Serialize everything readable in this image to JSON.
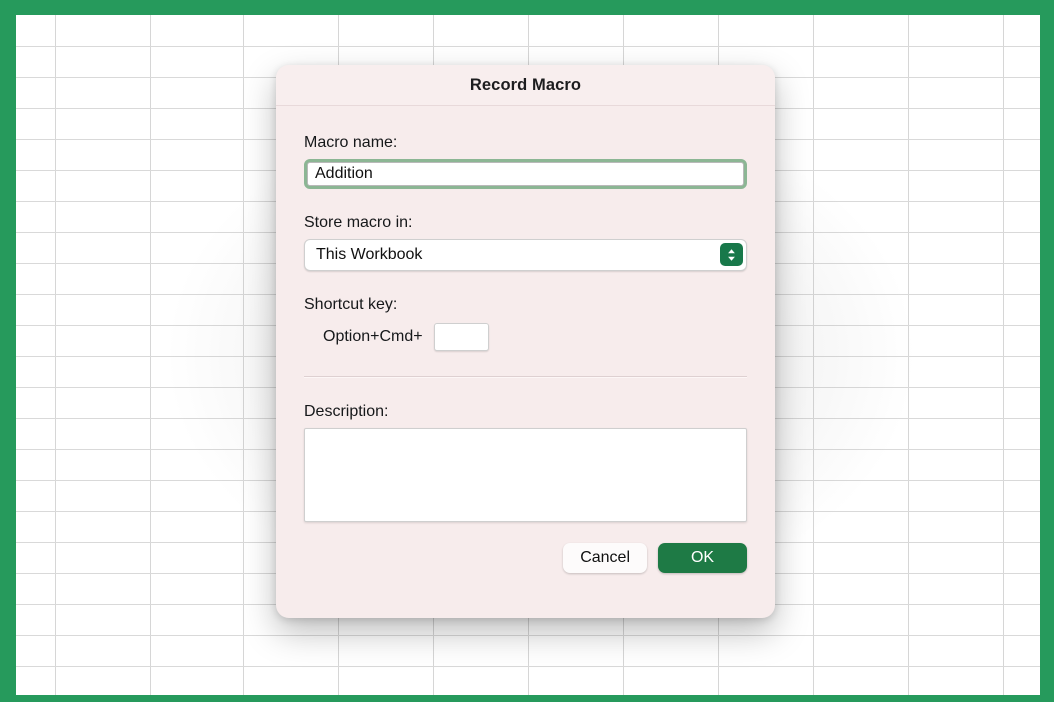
{
  "window": {
    "background_app": "spreadsheet",
    "accent_color": "#269a5c"
  },
  "dialog": {
    "title": "Record Macro",
    "fields": {
      "macro_name": {
        "label": "Macro name:",
        "value": "Addition",
        "placeholder": "",
        "focused": true
      },
      "store_macro_in": {
        "label": "Store macro in:",
        "selected": "This Workbook",
        "stepper_icon": "chevron-up-down-icon"
      },
      "shortcut_key": {
        "label": "Shortcut key:",
        "prefix": "Option+Cmd+",
        "value": "",
        "placeholder": ""
      },
      "description": {
        "label": "Description:",
        "value": "",
        "placeholder": ""
      }
    },
    "buttons": {
      "cancel": "Cancel",
      "ok": "OK",
      "ok_color": "#1e7a45"
    }
  }
}
